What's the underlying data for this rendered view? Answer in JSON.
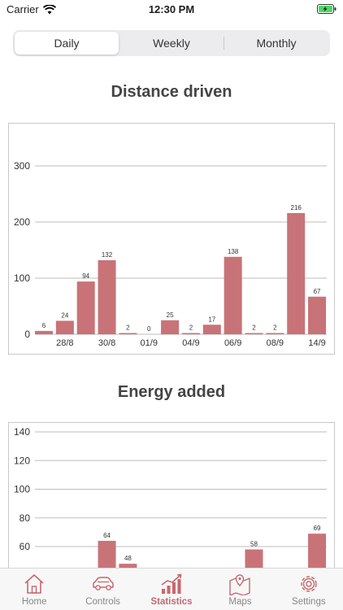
{
  "status": {
    "carrier": "Carrier",
    "time": "12:30 PM"
  },
  "colors": {
    "accent": "#c9676e",
    "bar": "#c87377",
    "inactive": "#8e8e93"
  },
  "segmented": {
    "items": [
      "Daily",
      "Weekly",
      "Monthly"
    ],
    "selected": "Daily"
  },
  "distance": {
    "title": "Distance driven"
  },
  "energy": {
    "title": "Energy added"
  },
  "tabs": [
    {
      "label": "Home",
      "icon": "home-icon"
    },
    {
      "label": "Controls",
      "icon": "car-icon"
    },
    {
      "label": "Statistics",
      "icon": "statistics-icon",
      "active": true
    },
    {
      "label": "Maps",
      "icon": "map-icon"
    },
    {
      "label": "Settings",
      "icon": "gear-icon"
    }
  ],
  "chart_data": [
    {
      "type": "bar",
      "title": "Distance driven",
      "values": [
        6,
        24,
        94,
        132,
        2,
        0,
        25,
        2,
        17,
        138,
        2,
        2,
        216,
        67
      ],
      "x_tick_labels": [
        "28/8",
        "30/8",
        "01/9",
        "04/9",
        "06/9",
        "08/9",
        "14/9"
      ],
      "y_ticks": [
        0,
        100,
        200,
        300
      ],
      "ylim": [
        0,
        300
      ],
      "grid": true
    },
    {
      "type": "bar",
      "title": "Energy added",
      "values": [
        null,
        null,
        null,
        64,
        48,
        null,
        null,
        null,
        null,
        null,
        58,
        null,
        null,
        69
      ],
      "y_ticks": [
        60,
        80,
        100,
        120,
        140
      ],
      "ylim": [
        60,
        140
      ],
      "grid": true
    }
  ]
}
